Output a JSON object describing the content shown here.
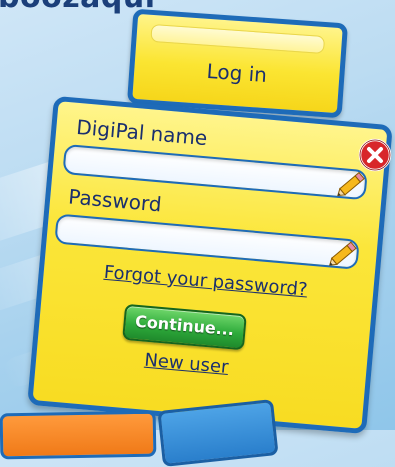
{
  "header": {
    "title_fragment": "boozaqui"
  },
  "login_tab": {
    "label": "Log in"
  },
  "form": {
    "name_label": "DigiPal name",
    "name_value": "",
    "password_label": "Password",
    "password_value": "",
    "forgot_link": "Forgot your password?",
    "continue_label": "Continue...",
    "new_user_link": "New user"
  },
  "icons": {
    "close": "close-icon",
    "pencil": "pencil-icon"
  },
  "colors": {
    "panel_yellow": "#fbe63a",
    "border_blue": "#1e6bb8",
    "text_navy": "#1a2f6e",
    "button_green": "#2eab3b",
    "close_red": "#d8262a"
  }
}
